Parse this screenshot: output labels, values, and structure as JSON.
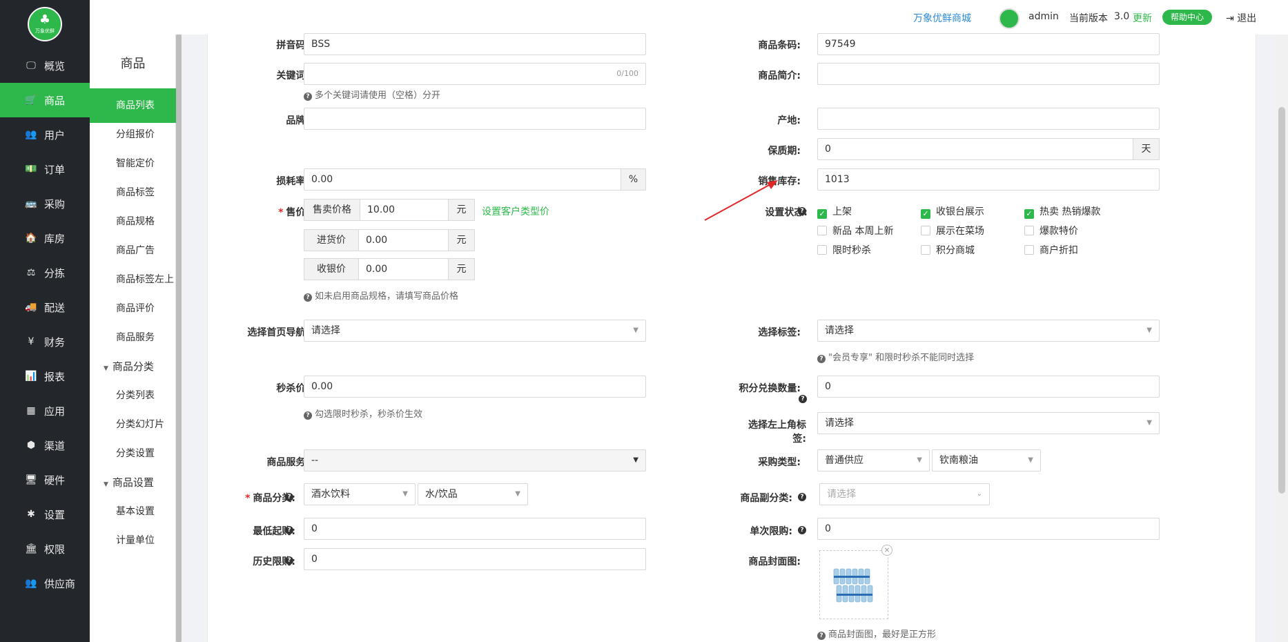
{
  "logo": {
    "text": "万象优鲜"
  },
  "nav": {
    "items": [
      {
        "label": "概览",
        "icon": "monitor-icon",
        "glyph": "🖵"
      },
      {
        "label": "商品",
        "icon": "cart-icon",
        "glyph": "🛒"
      },
      {
        "label": "用户",
        "icon": "users-icon",
        "glyph": "👥"
      },
      {
        "label": "订单",
        "icon": "money-icon",
        "glyph": "💵"
      },
      {
        "label": "采购",
        "icon": "bus-icon",
        "glyph": "🚌"
      },
      {
        "label": "库房",
        "icon": "home-icon",
        "glyph": "🏠"
      },
      {
        "label": "分拣",
        "icon": "scale-icon",
        "glyph": "⚖"
      },
      {
        "label": "配送",
        "icon": "truck-icon",
        "glyph": "🚚"
      },
      {
        "label": "财务",
        "icon": "yen-icon",
        "glyph": "¥"
      },
      {
        "label": "报表",
        "icon": "bar-chart-icon",
        "glyph": "📊"
      },
      {
        "label": "应用",
        "icon": "apps-icon",
        "glyph": "▦"
      },
      {
        "label": "渠道",
        "icon": "cube-icon",
        "glyph": "⬢"
      },
      {
        "label": "硬件",
        "icon": "desktop-icon",
        "glyph": "🖥"
      },
      {
        "label": "设置",
        "icon": "puzzle-icon",
        "glyph": "✱"
      },
      {
        "label": "权限",
        "icon": "bank-icon",
        "glyph": "🏛"
      },
      {
        "label": "供应商",
        "icon": "supplier-users-icon",
        "glyph": "👥"
      }
    ]
  },
  "submenu": {
    "title": "商品",
    "items": [
      "商品列表",
      "分组报价",
      "智能定价",
      "商品标签",
      "商品规格",
      "商品广告",
      "商品标签左上",
      "商品评价",
      "商品服务"
    ],
    "group1": "商品分类",
    "group1_items": [
      "分类列表",
      "分类幻灯片",
      "分类设置"
    ],
    "group2": "商品设置",
    "group2_items": [
      "基本设置",
      "计量单位"
    ]
  },
  "header": {
    "shop_link": "万象优鲜商城",
    "user": "admin",
    "version_label": "当前版本",
    "version": "3.0",
    "update": "更新",
    "help": "帮助中心",
    "logout": "退出"
  },
  "form": {
    "pinyin_label": "拼音码:",
    "pinyin": "BSS",
    "barcode_label": "商品条码:",
    "barcode": "97549",
    "keyword_label": "关键词:",
    "keyword_count": "0/100",
    "keyword_hint": "多个关键词请使用（空格）分开",
    "brief_label": "商品简介:",
    "brand_label": "品牌:",
    "origin_label": "产地:",
    "shelf_label": "保质期:",
    "shelf": "0",
    "shelf_unit": "天",
    "loss_label": "损耗率:",
    "loss": "0.00",
    "loss_unit": "%",
    "stock_label": "销售库存:",
    "stock": "1013",
    "price_label": "售价:",
    "sell_price_label": "售卖价格",
    "sell_price": "10.00",
    "yuan": "元",
    "customer_price_link": "设置客户类型价",
    "buy_price_label": "进货价",
    "buy_price": "0.00",
    "cash_price_label": "收银价",
    "cash_price": "0.00",
    "price_hint": "如未启用商品规格，请填写商品价格",
    "status_label": "设置状态:",
    "status_options": [
      {
        "label": "上架",
        "checked": true
      },
      {
        "label": "收银台展示",
        "checked": true
      },
      {
        "label": "热卖 热销爆款",
        "checked": true
      },
      {
        "label": "新品 本周上新",
        "checked": false
      },
      {
        "label": "展示在菜场",
        "checked": false
      },
      {
        "label": "爆款特价",
        "checked": false
      },
      {
        "label": "限时秒杀",
        "checked": false
      },
      {
        "label": "积分商城",
        "checked": false
      },
      {
        "label": "商户折扣",
        "checked": false
      }
    ],
    "home_nav_label": "选择首页导航:",
    "home_nav": "请选择",
    "tag_label": "选择标签:",
    "tag": "请选择",
    "tag_hint": "\"会员专享\" 和限时秒杀不能同时选择",
    "seckill_label": "秒杀价:",
    "seckill": "0.00",
    "seckill_hint": "勾选限时秒杀，秒杀价生效",
    "points_label": "积分兑换数量:",
    "points": "0",
    "corner_tag_label_1": "选择左上角标",
    "corner_tag_label_2": "签:",
    "corner_tag": "请选择",
    "service_label": "商品服务:",
    "service": "--",
    "purchase_type_label": "采购类型:",
    "purchase_type": "普通供应",
    "purchase_supplier": "钦南粮油",
    "category_label": "商品分类:",
    "category_1": "酒水饮料",
    "category_2": "水/饮品",
    "sub_category_label": "商品副分类:",
    "sub_category_placeholder": "请选择",
    "min_buy_label": "最低起购:",
    "min_buy": "0",
    "single_limit_label": "单次限购:",
    "single_limit": "0",
    "history_limit_label": "历史限购:",
    "history_limit": "0",
    "cover_label": "商品封面图:",
    "cover_hint": "商品封面图，最好是正方形"
  },
  "colors": {
    "brand": "#2eb84b",
    "sidebar": "#23272b",
    "link": "#2b8bd8",
    "arrow": "#e02828"
  }
}
